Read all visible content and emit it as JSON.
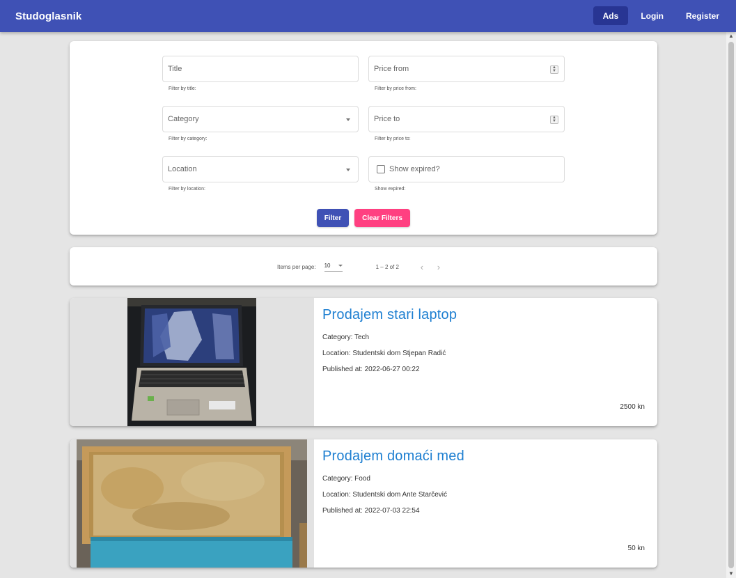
{
  "app": {
    "brand": "Studoglasnik"
  },
  "nav": {
    "ads": "Ads",
    "login": "Login",
    "register": "Register"
  },
  "filters": {
    "title": {
      "placeholder": "Title",
      "hint": "Filter by title:"
    },
    "price_from": {
      "placeholder": "Price from",
      "hint": "Filter by price from:"
    },
    "category": {
      "placeholder": "Category",
      "hint": "Filter by category:"
    },
    "price_to": {
      "placeholder": "Price to",
      "hint": "Filter by price to:"
    },
    "location": {
      "placeholder": "Location",
      "hint": "Filter by location:"
    },
    "expired": {
      "label": "Show expired?",
      "hint": "Show expired:"
    },
    "filter_btn": "Filter",
    "clear_btn": "Clear Filters"
  },
  "paginator": {
    "label": "Items per page:",
    "page_size": "10",
    "range": "1 – 2 of 2",
    "prev": "‹",
    "next": "›"
  },
  "ads": [
    {
      "title": "Prodajem stari laptop",
      "category": "Category: Tech",
      "location": "Location: Studentski dom Stjepan Radić",
      "published": "Published at: 2022-06-27 00:22",
      "price": "2500 kn"
    },
    {
      "title": "Prodajem domaći med",
      "category": "Category: Food",
      "location": "Location: Studentski dom Ante Starčević",
      "published": "Published at: 2022-07-03 22:54",
      "price": "50 kn"
    }
  ],
  "colors": {
    "primary": "#3f51b5",
    "accent": "#ff4081",
    "link": "#1e7fd1"
  }
}
